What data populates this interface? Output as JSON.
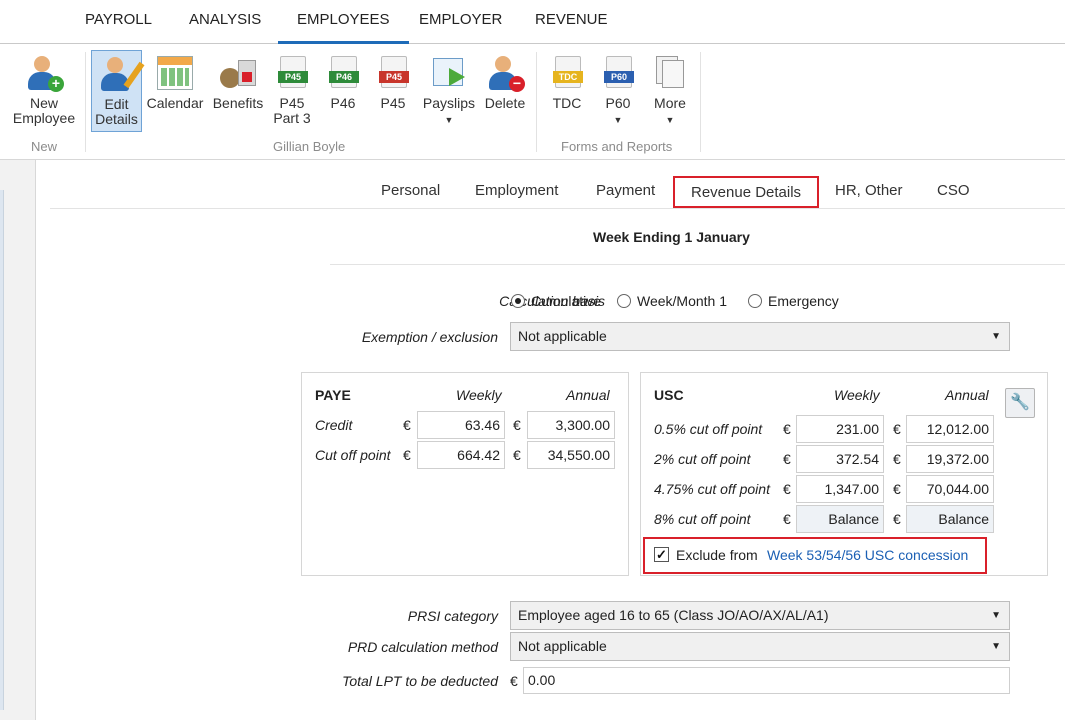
{
  "menu": {
    "tabs": [
      "PAYROLL",
      "ANALYSIS",
      "EMPLOYEES",
      "EMPLOYER",
      "REVENUE"
    ],
    "active": "EMPLOYEES"
  },
  "ribbon": {
    "new_employee": "New\nEmployee",
    "edit_details": "Edit\nDetails",
    "calendar": "Calendar",
    "benefits": "Benefits",
    "p45_part3": "P45\nPart 3",
    "p46": "P46",
    "p45": "P45",
    "payslips": "Payslips",
    "delete": "Delete",
    "tdc": "TDC",
    "p60": "P60",
    "more": "More",
    "icon_p45": "P45",
    "icon_p46": "P46",
    "icon_tdc": "TDC",
    "icon_p60": "P60",
    "groups": {
      "new": "New",
      "employee": "Gillian Boyle",
      "forms": "Forms and Reports"
    }
  },
  "page_tabs": [
    "Personal",
    "Employment",
    "Payment",
    "Revenue Details",
    "HR, Other",
    "CSO"
  ],
  "active_tab": "Revenue Details",
  "week_title": "Week Ending 1 January",
  "calc_basis": {
    "label": "Calculation basis",
    "options": [
      "Cumulative",
      "Week/Month 1",
      "Emergency"
    ],
    "selected": "Cumulative"
  },
  "exemption": {
    "label": "Exemption / exclusion",
    "value": "Not applicable"
  },
  "currency": "€",
  "paye": {
    "title": "PAYE",
    "weekly": "Weekly",
    "annual": "Annual",
    "rows": [
      {
        "label": "Credit",
        "weekly": "63.46",
        "annual": "3,300.00"
      },
      {
        "label": "Cut off point",
        "weekly": "664.42",
        "annual": "34,550.00"
      }
    ]
  },
  "usc": {
    "title": "USC",
    "weekly": "Weekly",
    "annual": "Annual",
    "rows": [
      {
        "label": "0.5% cut off point",
        "weekly": "231.00",
        "annual": "12,012.00"
      },
      {
        "label": "2% cut off point",
        "weekly": "372.54",
        "annual": "19,372.00"
      },
      {
        "label": "4.75% cut off point",
        "weekly": "1,347.00",
        "annual": "70,044.00"
      },
      {
        "label": "8% cut off point",
        "weekly": "Balance",
        "annual": "Balance"
      }
    ],
    "exclude_label": "Exclude from ",
    "exclude_link": "Week 53/54/56 USC concession",
    "exclude_checked": true
  },
  "prsi": {
    "label": "PRSI category",
    "value": "Employee aged 16 to 65 (Class JO/AO/AX/AL/A1)"
  },
  "prd": {
    "label": "PRD calculation method",
    "value": "Not applicable"
  },
  "lpt": {
    "label": "Total LPT to be deducted",
    "value": "0.00"
  },
  "colors": {
    "accent": "#1e6bb8",
    "highlight": "#d9202a",
    "link": "#1a5fb4"
  }
}
